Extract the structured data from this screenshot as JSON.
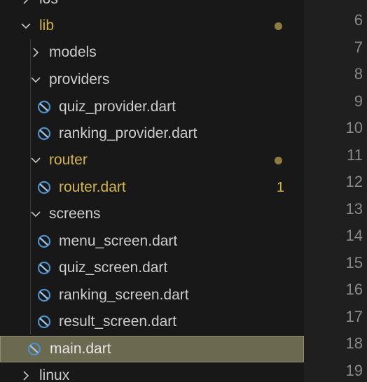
{
  "explorer": {
    "ios_label": "ios",
    "lib": {
      "label": "lib"
    },
    "models": {
      "label": "models"
    },
    "providers": {
      "label": "providers"
    },
    "quiz_provider": {
      "label": "quiz_provider.dart"
    },
    "ranking_provider": {
      "label": "ranking_provider.dart"
    },
    "router": {
      "label": "router"
    },
    "router_dart": {
      "label": "router.dart",
      "problem_count": "1"
    },
    "screens": {
      "label": "screens"
    },
    "menu_screen": {
      "label": "menu_screen.dart"
    },
    "quiz_screen": {
      "label": "quiz_screen.dart"
    },
    "ranking_screen": {
      "label": "ranking_screen.dart"
    },
    "result_screen": {
      "label": "result_screen.dart"
    },
    "main_dart": {
      "label": "main.dart"
    },
    "linux": {
      "label": "linux"
    }
  },
  "editor": {
    "line_numbers": [
      "6",
      "7",
      "8",
      "9",
      "10",
      "11",
      "12",
      "13",
      "14",
      "15",
      "16",
      "17",
      "18",
      "19"
    ]
  },
  "colors": {
    "modified": "#d1b34c",
    "selected_bg": "#6b6950",
    "dart_icon": "#4f8fc9"
  },
  "icons": {
    "chevron_right": "chevron-right-icon",
    "chevron_down": "chevron-down-icon",
    "dart": "dart-file-icon"
  }
}
